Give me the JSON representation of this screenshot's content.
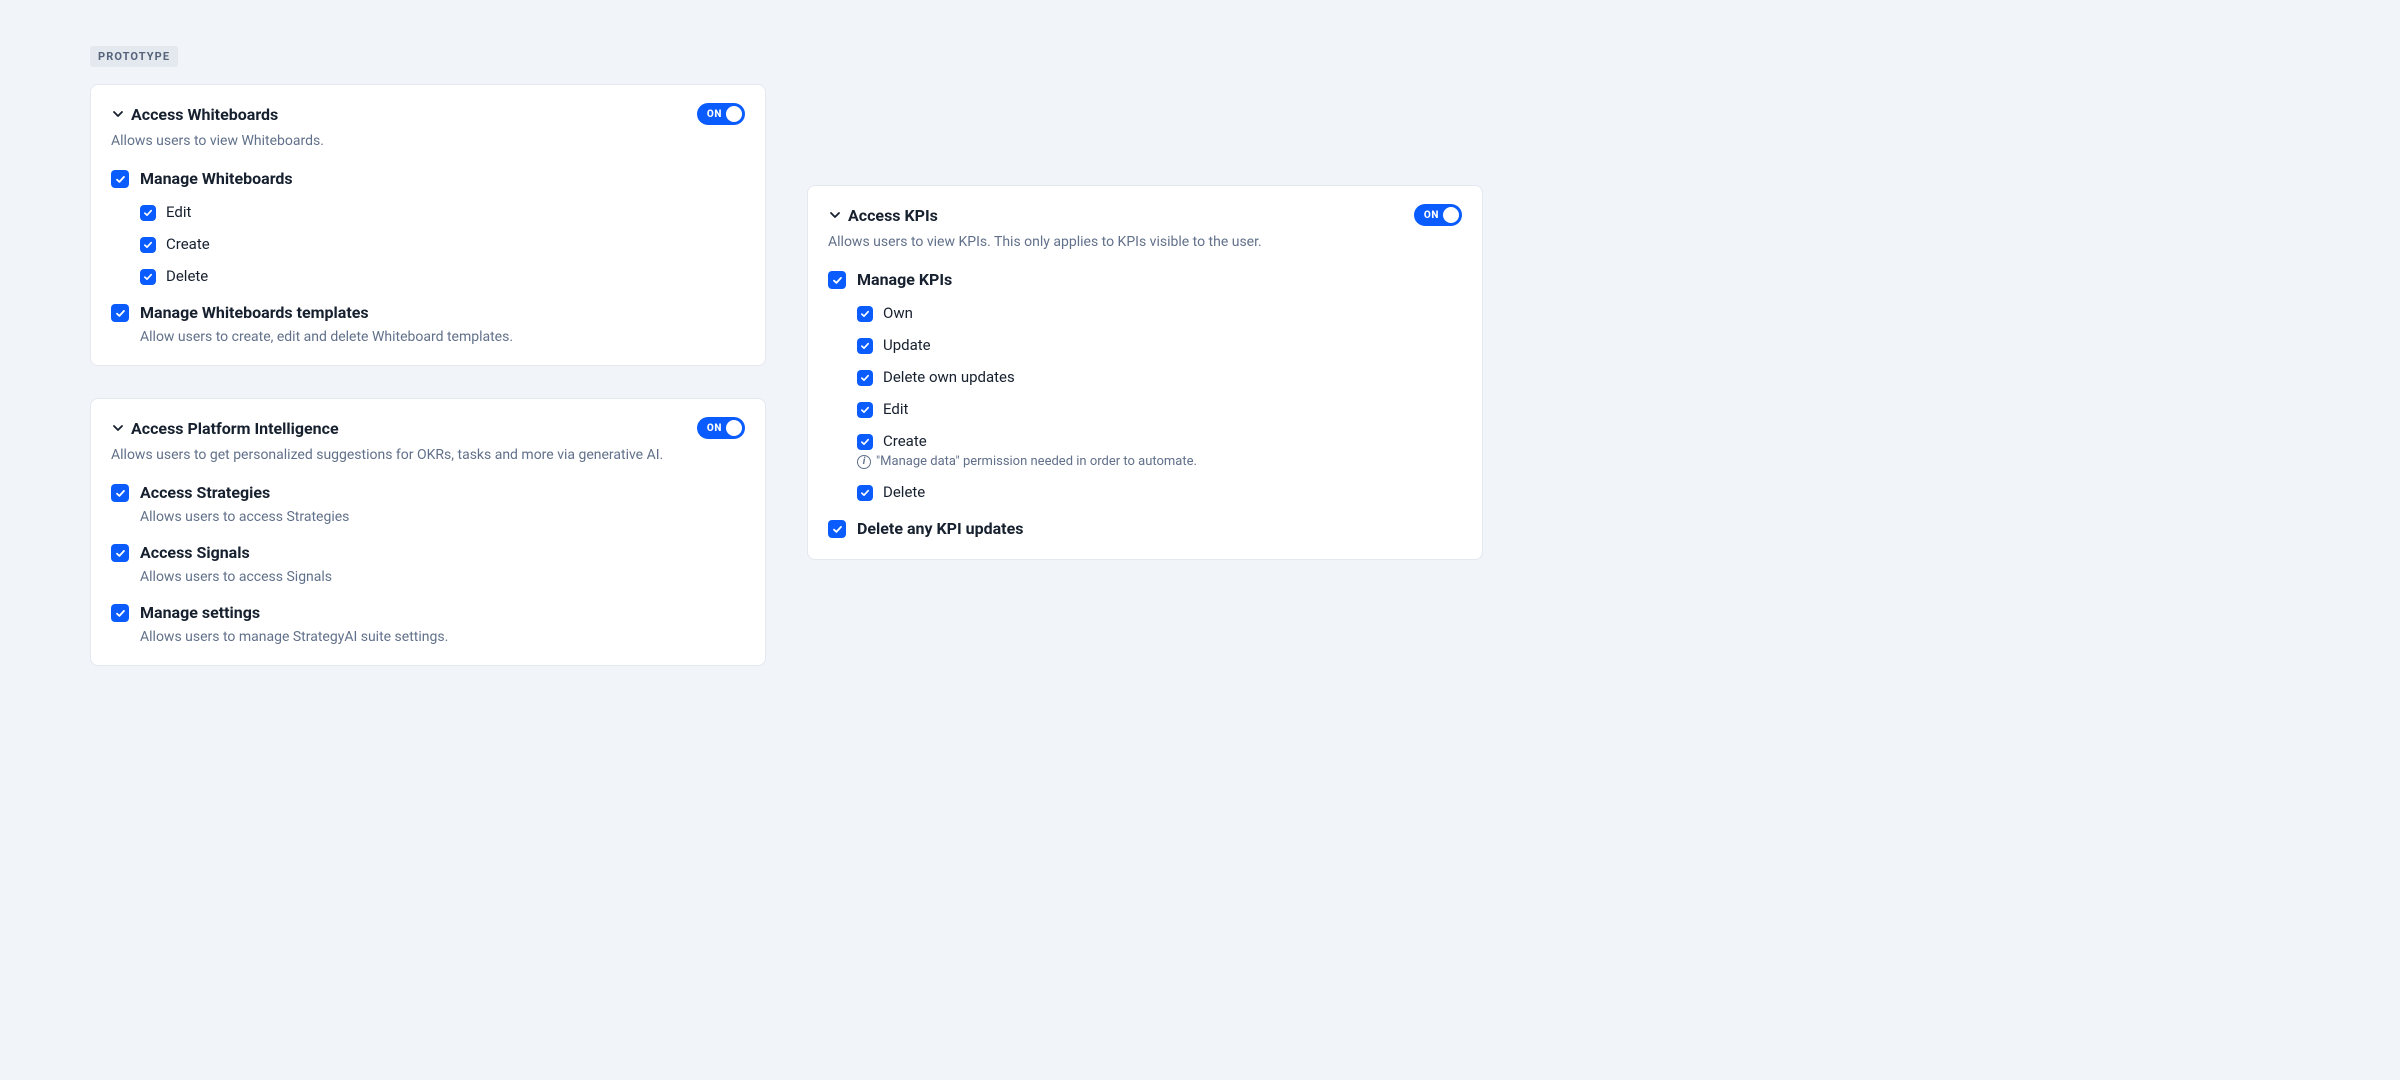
{
  "badge": "PROTOTYPE",
  "toggle_on_label": "ON",
  "cards": {
    "whiteboards": {
      "title": "Access Whiteboards",
      "description": "Allows users to view Whiteboards.",
      "toggle_on": true,
      "perms": [
        {
          "title": "Manage Whiteboards",
          "checked": true,
          "children": [
            {
              "label": "Edit",
              "checked": true
            },
            {
              "label": "Create",
              "checked": true
            },
            {
              "label": "Delete",
              "checked": true
            }
          ]
        },
        {
          "title": "Manage Whiteboards templates",
          "description": "Allow users to create, edit and delete Whiteboard templates.",
          "checked": true
        }
      ]
    },
    "platform_intelligence": {
      "title": "Access Platform Intelligence",
      "description": "Allows users to get personalized suggestions for OKRs, tasks and more via generative AI.",
      "toggle_on": true,
      "perms": [
        {
          "title": "Access Strategies",
          "description": "Allows users to access Strategies",
          "checked": true
        },
        {
          "title": "Access Signals",
          "description": "Allows users to access Signals",
          "checked": true
        },
        {
          "title": "Manage settings",
          "description": "Allows users to manage StrategyAI suite settings.",
          "checked": true
        }
      ]
    },
    "kpis": {
      "title": "Access KPIs",
      "description": "Allows users to view KPIs. This only applies to KPIs visible to the user.",
      "toggle_on": true,
      "perms": [
        {
          "title": "Manage KPIs",
          "checked": true,
          "children": [
            {
              "label": "Own",
              "checked": true
            },
            {
              "label": "Update",
              "checked": true
            },
            {
              "label": "Delete own updates",
              "checked": true
            },
            {
              "label": "Edit",
              "checked": true
            },
            {
              "label": "Create",
              "checked": true,
              "note": "\"Manage data\" permission needed in order to automate."
            },
            {
              "label": "Delete",
              "checked": true
            }
          ]
        },
        {
          "title": "Delete any KPI updates",
          "checked": true
        }
      ]
    }
  }
}
